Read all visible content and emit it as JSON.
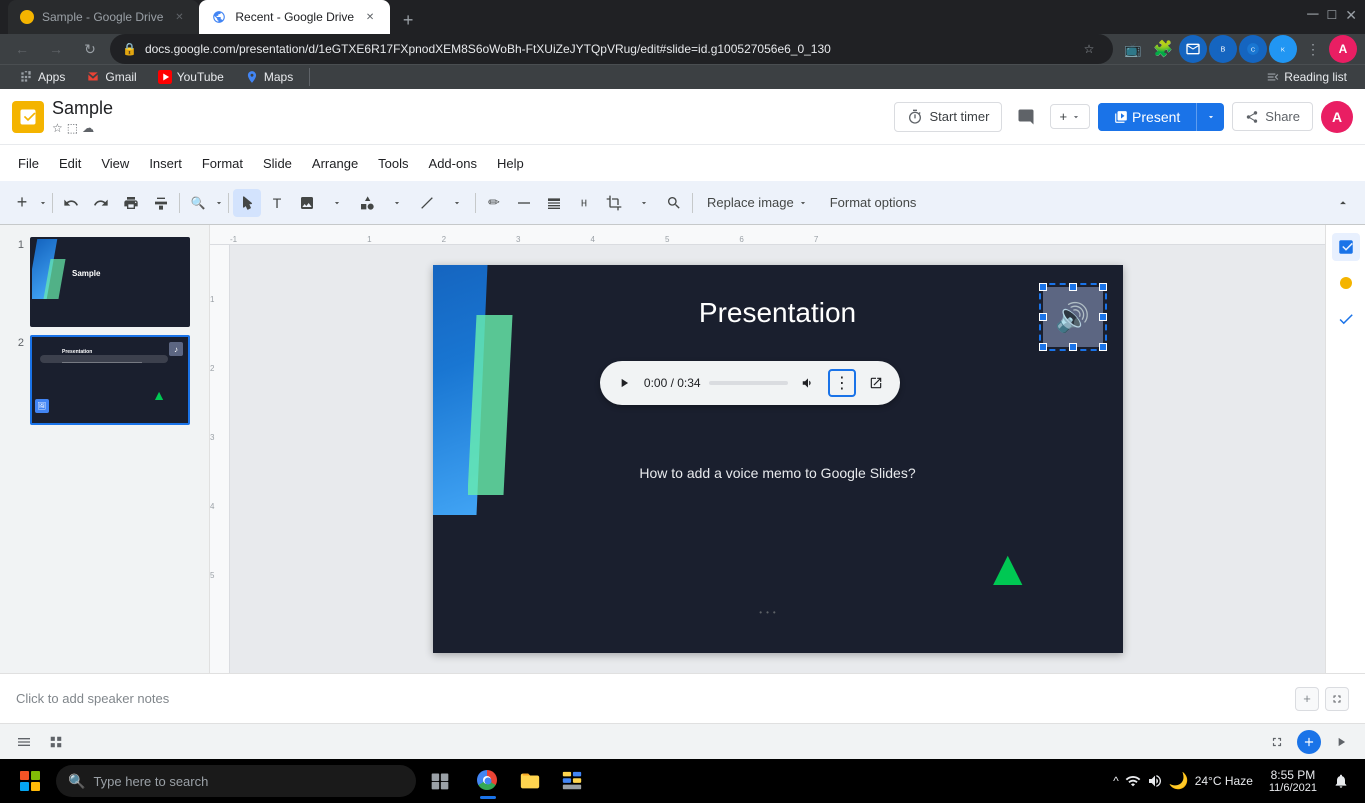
{
  "browser": {
    "tabs": [
      {
        "id": "tab1",
        "label": "Sample - Google Drive",
        "url": "docs.google.com/presentation/d/1eGTXE6R17FXpnodXEM8S6oWoBh-FtXUiZeJYTQpVRug/edit#slide=id.g100527056e6_0_130",
        "active": false,
        "favicon": "yellow-drive"
      },
      {
        "id": "tab2",
        "label": "Recent - Google Drive",
        "url": "",
        "active": true,
        "favicon": "blue-drive"
      }
    ],
    "url": "docs.google.com/presentation/d/1eGTXE6R17FXpnodXEM8S6oWoBh-FtXUiZeJYTQpVRug/edit#slide=id.g100527056e6_0_130",
    "bookmarks": [
      {
        "label": "Apps",
        "icon": "apps"
      },
      {
        "label": "Gmail",
        "icon": "gmail"
      },
      {
        "label": "YouTube",
        "icon": "youtube"
      },
      {
        "label": "Maps",
        "icon": "maps"
      }
    ],
    "reading_list": "Reading list"
  },
  "docs": {
    "title": "Sample",
    "menu": {
      "file": "File",
      "edit": "Edit",
      "view": "View",
      "insert": "Insert",
      "format": "Format",
      "slide": "Slide",
      "arrange": "Arrange",
      "tools": "Tools",
      "addons": "Add-ons",
      "help": "Help"
    },
    "toolbar": {
      "replace_image": "Replace image",
      "format_options": "Format options"
    },
    "header_actions": {
      "start_timer": "Start timer",
      "present": "Present",
      "share": "Share"
    },
    "slides": [
      {
        "number": "1",
        "thumb_title": "Sample"
      },
      {
        "number": "2",
        "thumb_title": "Presentation"
      }
    ],
    "slide2": {
      "title": "Presentation",
      "text": "How to add a voice memo to Google Slides?",
      "audio_time": "0:00 / 0:34"
    },
    "notes_placeholder": "Click to add speaker notes"
  },
  "taskbar": {
    "search_placeholder": "Type here to search",
    "clock_time": "8:55 PM",
    "clock_date": "11/6/2021",
    "weather": "24°C  Haze"
  }
}
